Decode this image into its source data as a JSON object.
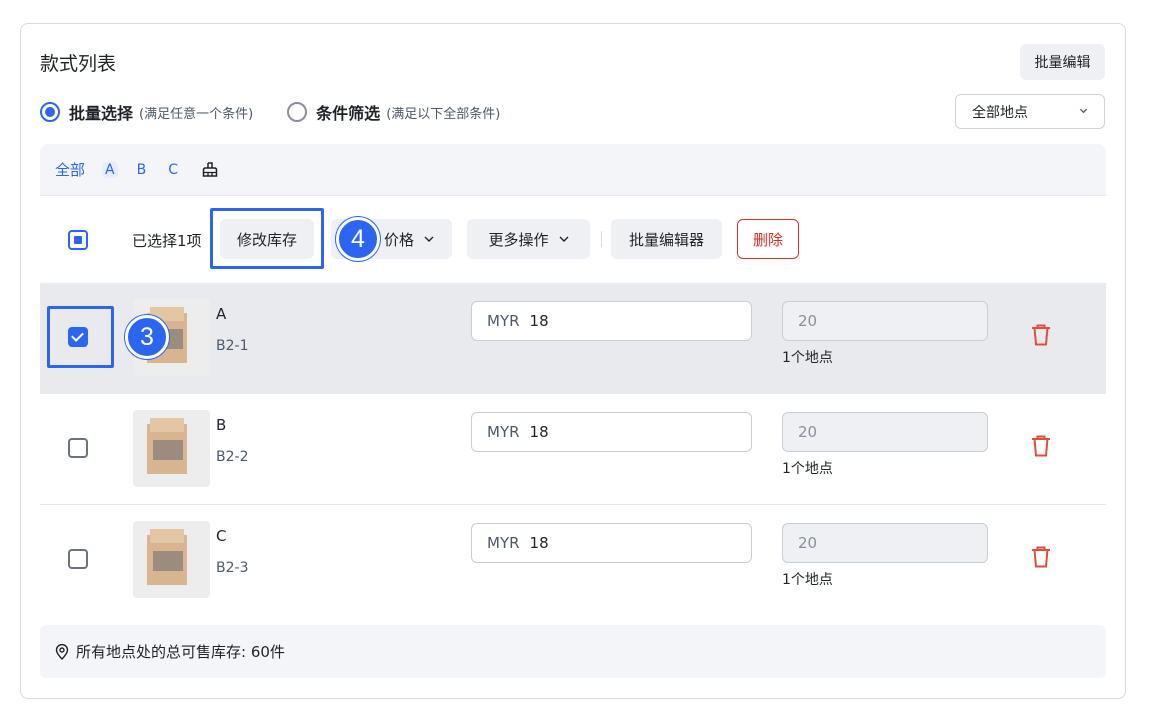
{
  "header": {
    "title": "款式列表",
    "batch_edit_label": "批量编辑"
  },
  "mode": {
    "batch_select_label": "批量选择",
    "batch_select_hint": "(满足任意一个条件)",
    "condition_filter_label": "条件筛选",
    "condition_filter_hint": "(满足以下全部条件)",
    "selected": "批量选择"
  },
  "location_select": {
    "value": "全部地点"
  },
  "filter_bar": {
    "all_label": "全部",
    "letters": [
      "A",
      "B",
      "C"
    ],
    "clear_icon": "broom-icon"
  },
  "action_bar": {
    "selected_count": "已选择1项",
    "modify_stock_label": "修改库存",
    "price_label": "价格",
    "more_actions_label": "更多操作",
    "bulk_editor_label": "批量编辑器",
    "delete_label": "删除"
  },
  "rows": [
    {
      "name": "A",
      "sku": "B2-1",
      "currency": "MYR",
      "price": "18",
      "stock": "20",
      "locations": "1个地点",
      "checked": true
    },
    {
      "name": "B",
      "sku": "B2-2",
      "currency": "MYR",
      "price": "18",
      "stock": "20",
      "locations": "1个地点",
      "checked": false
    },
    {
      "name": "C",
      "sku": "B2-3",
      "currency": "MYR",
      "price": "18",
      "stock": "20",
      "locations": "1个地点",
      "checked": false
    }
  ],
  "footer": {
    "total_text": "所有地点处的总可售库存: 60件"
  },
  "annotations": {
    "step_3": "3",
    "step_4": "4"
  },
  "colors": {
    "accent": "#2b65f0",
    "danger": "#d93026",
    "selected_row": "#e9eaee"
  }
}
